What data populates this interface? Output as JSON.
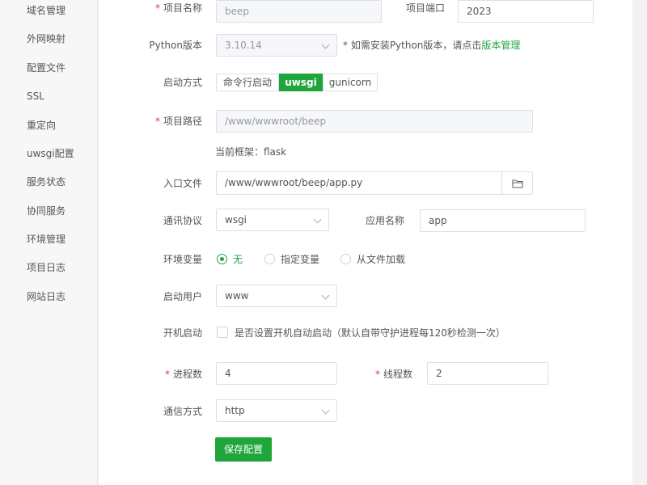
{
  "sidebar": {
    "items": [
      {
        "label": "域名管理"
      },
      {
        "label": "外网映射"
      },
      {
        "label": "配置文件"
      },
      {
        "label": "SSL"
      },
      {
        "label": "重定向"
      },
      {
        "label": "uwsgi配置"
      },
      {
        "label": "服务状态"
      },
      {
        "label": "协同服务"
      },
      {
        "label": "环境管理"
      },
      {
        "label": "项目日志"
      },
      {
        "label": "网站日志"
      }
    ]
  },
  "form": {
    "project_name": {
      "label": "项目名称",
      "value": "beep"
    },
    "project_port": {
      "label": "项目端口",
      "value": "2023"
    },
    "python_version": {
      "label": "Python版本",
      "value": "3.10.14",
      "hint": "* 如需安装Python版本，请点击",
      "hint_link": "版本管理"
    },
    "start_mode": {
      "label": "启动方式",
      "options": [
        "命令行启动",
        "uwsgi",
        "gunicorn"
      ],
      "selected": "uwsgi"
    },
    "project_path": {
      "label": "项目路径",
      "value": "/www/wwwroot/beep",
      "framework": "当前框架：flask"
    },
    "entry_file": {
      "label": "入口文件",
      "value": "/www/wwwroot/beep/app.py"
    },
    "protocol": {
      "label": "通讯协议",
      "value": "wsgi"
    },
    "app_name": {
      "label": "应用名称",
      "value": "app"
    },
    "env_vars": {
      "label": "环境变量",
      "options": [
        "无",
        "指定变量",
        "从文件加载"
      ],
      "selected": "无"
    },
    "start_user": {
      "label": "启动用户",
      "value": "www"
    },
    "autostart": {
      "label": "开机启动",
      "text": "是否设置开机自动启动（默认自带守护进程每120秒检测一次）"
    },
    "processes": {
      "label": "进程数",
      "value": "4"
    },
    "threads": {
      "label": "线程数",
      "value": "2"
    },
    "comm_mode": {
      "label": "通信方式",
      "value": "http"
    },
    "save_label": "保存配置"
  },
  "colors": {
    "accent": "#20a53a",
    "required": "#e53935"
  }
}
